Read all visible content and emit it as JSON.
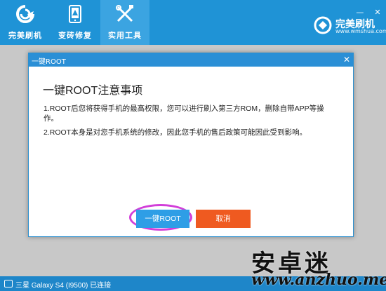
{
  "titlebar": {
    "tabs": [
      {
        "label": "完美刷机",
        "icon": "refresh-icon"
      },
      {
        "label": "变砖修复",
        "icon": "phone-alert-icon"
      },
      {
        "label": "实用工具",
        "icon": "tools-icon"
      }
    ],
    "active_tab": 2,
    "brand_name": "完美刷机",
    "brand_url": "www.wmshua.com",
    "minimize": "—",
    "close": "✕"
  },
  "dialog": {
    "title": "一键ROOT",
    "close": "✕",
    "heading": "一键ROOT注意事项",
    "para1": "1.ROOT后您将获得手机的最高权限，您可以进行刷入第三方ROM，删除自带APP等操作。",
    "para2": "2.ROOT本身是对您手机系统的修改，因此您手机的售后政策可能因此受到影响。",
    "root_button": "一键ROOT",
    "cancel_button": "取消"
  },
  "statusbar": {
    "device": "三星 Galaxy S4 (I9500) 已连接"
  },
  "watermark": {
    "cn": "安卓迷",
    "en": "www.anzhuo.me"
  },
  "colors": {
    "titlebar": "#1f93d6",
    "active_tab": "#3ba4e1",
    "root_button": "#2e9ee6",
    "cancel_button": "#ef5a20",
    "highlight": "#d23fd9"
  }
}
